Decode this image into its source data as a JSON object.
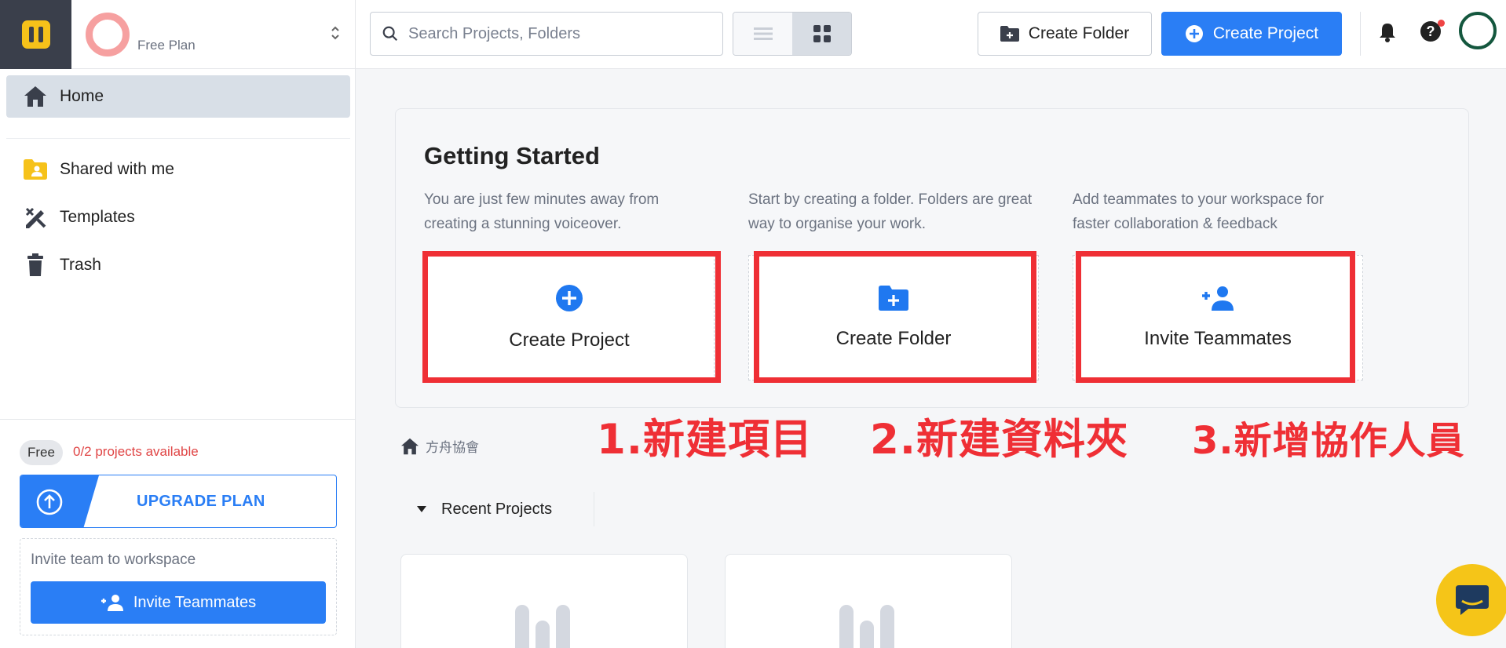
{
  "workspace": {
    "plan": "Free Plan"
  },
  "search": {
    "placeholder": "Search Projects, Folders"
  },
  "toolbar": {
    "create_folder": "Create Folder",
    "create_project": "Create Project"
  },
  "sidebar": {
    "items": [
      {
        "label": "Home",
        "icon": "home-icon",
        "active": true
      },
      {
        "label": "Shared with me",
        "icon": "shared-folder-icon"
      },
      {
        "label": "Templates",
        "icon": "templates-icon"
      },
      {
        "label": "Trash",
        "icon": "trash-icon"
      }
    ],
    "plan_badge": "Free",
    "projects_available": "0/2 projects available",
    "upgrade_label": "UPGRADE PLAN",
    "invite_text": "Invite team to workspace",
    "invite_button": "Invite Teammates"
  },
  "getting_started": {
    "title": "Getting Started",
    "columns": [
      {
        "desc": "You are just few minutes away from creating a stunning voiceover.",
        "card_label": "Create Project",
        "icon": "plus-circle-icon"
      },
      {
        "desc": "Start by creating a folder. Folders are great way to organise your work.",
        "card_label": "Create Folder",
        "icon": "folder-plus-icon"
      },
      {
        "desc": "Add teammates to your workspace for faster collaboration & feedback",
        "card_label": "Invite Teammates",
        "icon": "user-plus-icon"
      }
    ]
  },
  "annotations": [
    "1.新建項目",
    "2.新建資料夾",
    "3.新增協作人員"
  ],
  "breadcrumb": {
    "label": "方舟協會"
  },
  "recent": {
    "label": "Recent Projects"
  },
  "colors": {
    "primary": "#2a7ef5",
    "annotation_red": "#ef2f35",
    "logo_yellow": "#f6c21a",
    "sidebar_dark": "#3a3f4b"
  }
}
